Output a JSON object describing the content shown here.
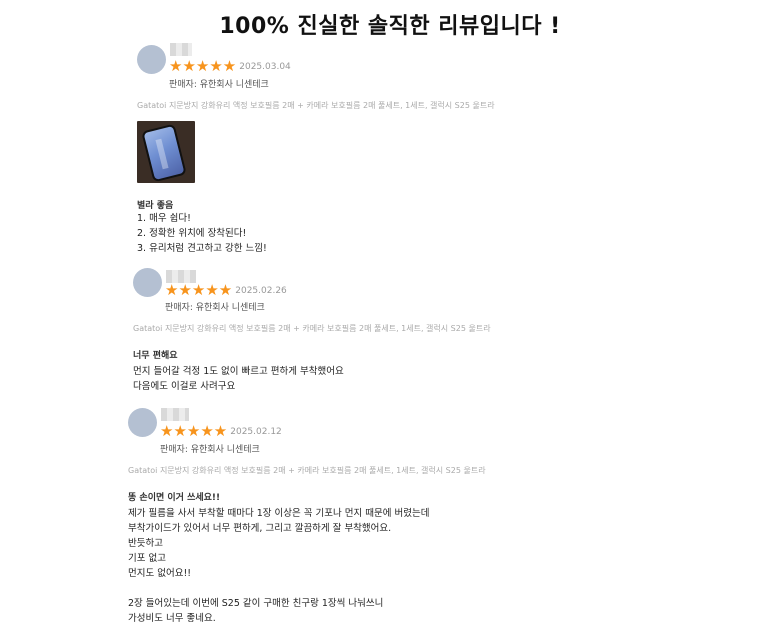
{
  "title": "100% 진실한 솔직한 리뷰입니다 !",
  "accent_color": "#f7941d",
  "reviews": [
    {
      "rating": 5,
      "stars": "★★★★★",
      "date": "2025.03.04",
      "seller": "판매자: 유한회사 니센테크",
      "product": "Gatatoi 지문방지 강화유리 액정 보호필름 2매 + 카메라 보호필름 2매 풀세트, 1세트, 갤럭시 S25 울트라",
      "has_photo": true,
      "headline": "별라 좋음",
      "lines": [
        "1. 매우 쉽다!",
        "2. 정확한 위치에 장착된다!",
        "3. 유리처럼 견고하고 강한 느낌!"
      ]
    },
    {
      "rating": 5,
      "stars": "★★★★★",
      "date": "2025.02.26",
      "seller": "판매자: 유한회사 니센테크",
      "product": "Gatatoi 지문방지 강화유리 액정 보호필름 2매 + 카메라 보호필름 2매 풀세트, 1세트, 갤럭시 S25 울트라",
      "has_photo": false,
      "headline": "너무 편해요",
      "lines": [
        "먼지 들어갈 걱정 1도 없이 빠르고 편하게 부착했어요",
        "다음에도 이걸로 사려구요"
      ]
    },
    {
      "rating": 5,
      "stars": "★★★★★",
      "date": "2025.02.12",
      "seller": "판매자: 유한회사 니센테크",
      "product": "Gatatoi 지문방지 강화유리 액정 보호필름 2매 + 카메라 보호필름 2매 풀세트, 1세트, 갤럭시 S25 울트라",
      "has_photo": false,
      "headline": "똥 손이면 이거 쓰세요!!",
      "lines": [
        "제가 필름을 사서 부착할 때마다 1장 이상은 꼭 기포나 먼지 때문에 버렸는데",
        "부착가이드가 있어서 너무 편하게, 그리고 깔끔하게 잘 부착했어요.",
        "반듯하고",
        "기포 없고",
        "먼지도 없어요!!",
        "",
        "2장 들어있는데 이번에 S25 같이 구매한 친구랑 1장씩 나눠쓰니",
        "가성비도 너무 좋네요."
      ]
    }
  ]
}
